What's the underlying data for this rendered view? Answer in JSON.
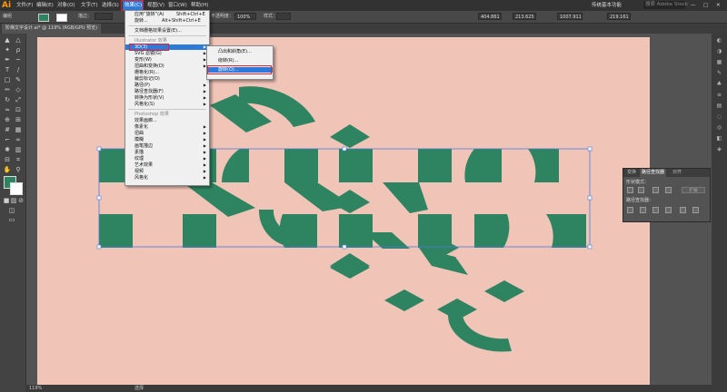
{
  "app": {
    "logo": "Ai"
  },
  "menubar": {
    "items": [
      "文件(F)",
      "编辑(E)",
      "对象(O)",
      "文字(T)",
      "选择(S)",
      "效果(C)",
      "视图(V)",
      "窗口(W)",
      "帮助(H)"
    ],
    "workspace": "传统基本功能",
    "search_placeholder": "搜索 Adobe Stock"
  },
  "controlbar": {
    "selection_label": "编组",
    "stroke_label": "描边：",
    "opacity_label": "不透明度：",
    "opacity_value": "100%",
    "style_label": "样式：",
    "x_value": "404.861",
    "y_value": "213.625",
    "w_value": "1007.911",
    "h_value": "219.161"
  },
  "document": {
    "tab_title": "阶梯文字设计.ai* @ 119% (RGB/GPU 预览)"
  },
  "colors": {
    "canvas": "#f1c4b8",
    "shape": "#2e8460",
    "highlight": "#2f7ad8",
    "accent_red": "#d9232e"
  },
  "effect_menu": {
    "apply_last": "应用“旋转”(A)",
    "apply_last_shortcut": "Shift+Ctrl+E",
    "rotate_last": "旋转...",
    "rotate_last_shortcut": "Alt+Shift+Ctrl+E",
    "raster_settings": "文档栅格效果设置(E)...",
    "illustrator_header": "Illustrator 效果",
    "illustrator_items": [
      "3D(3)",
      "SVG 滤镜(G)",
      "变形(W)",
      "扭曲和变换(D)",
      "栅格化(R)...",
      "裁剪标记(O)",
      "路径(P)",
      "路径查找器(F)",
      "转换为形状(V)",
      "风格化(S)"
    ],
    "photoshop_header": "Photoshop 效果",
    "photoshop_items": [
      "效果画廊...",
      "像素化",
      "扭曲",
      "模糊",
      "画笔描边",
      "素描",
      "纹理",
      "艺术效果",
      "视频",
      "风格化"
    ]
  },
  "submenu": {
    "items": [
      "凸出和斜角(E)...",
      "绕转(R)...",
      "旋转(O)..."
    ]
  },
  "pathfinder_panel": {
    "tabs": [
      "变换",
      "路径查找器",
      "对齐"
    ],
    "shape_modes_label": "形状模式：",
    "expand_button": "扩展",
    "pathfinders_label": "路径查找器："
  },
  "status": {
    "zoom": "119%",
    "tool": "选择"
  }
}
